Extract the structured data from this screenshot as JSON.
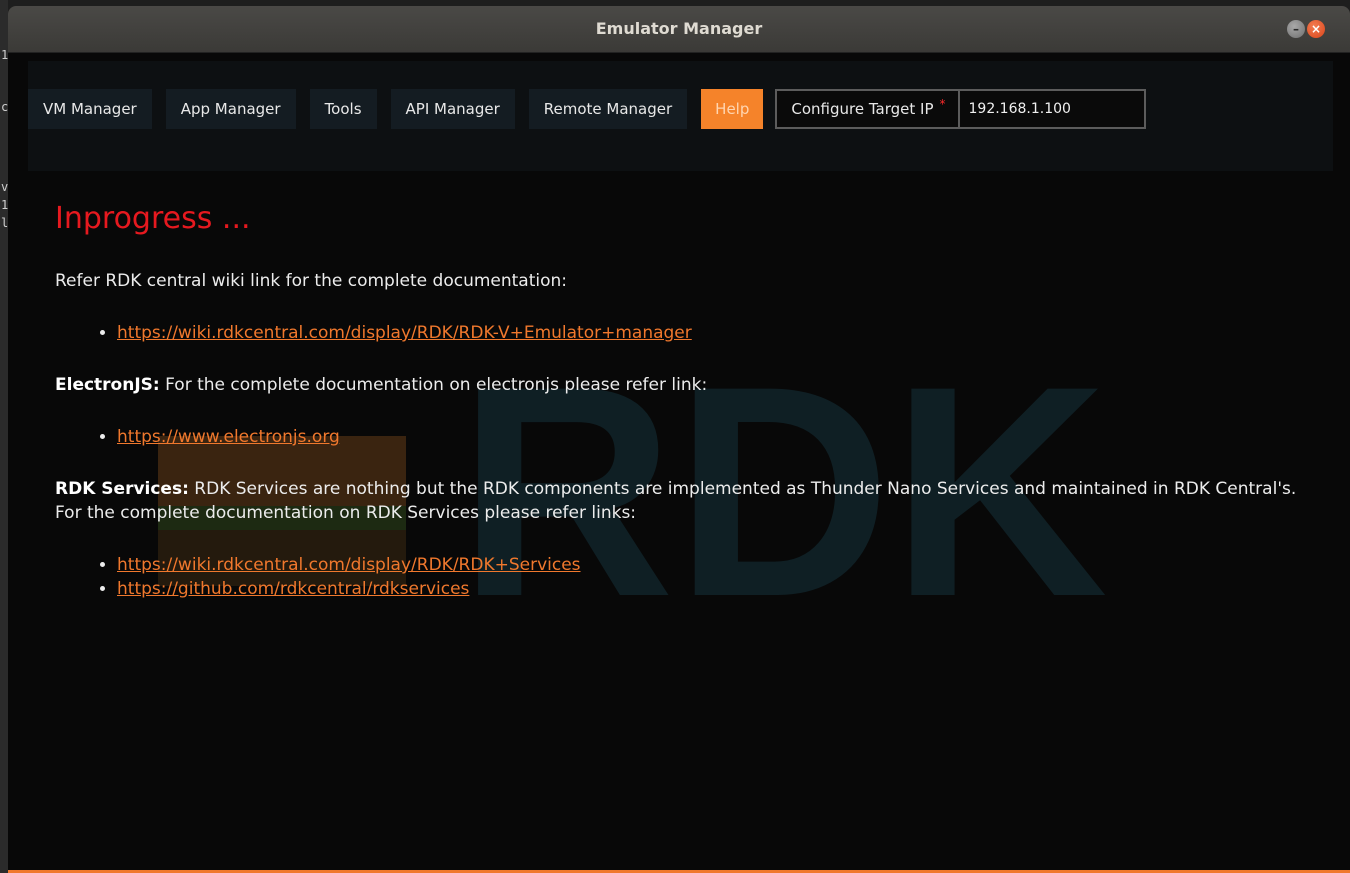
{
  "window": {
    "title": "Emulator Manager",
    "minimize_icon": "–",
    "close_icon": "×"
  },
  "nav": {
    "items": [
      {
        "label": "VM Manager"
      },
      {
        "label": "App Manager"
      },
      {
        "label": "Tools"
      },
      {
        "label": "API Manager"
      },
      {
        "label": "Remote Manager"
      },
      {
        "label": "Help",
        "active": true
      }
    ],
    "target": {
      "label": "Configure Target IP",
      "required_mark": "*",
      "value": "192.168.1.100"
    }
  },
  "content": {
    "heading": "Inprogress ...",
    "intro": "Refer RDK central wiki link for the complete documentation:",
    "wiki_link": "https://wiki.rdkcentral.com/display/RDK/RDK-V+Emulator+manager",
    "electron_label": "ElectronJS:",
    "electron_text": "For the complete documentation on electronjs please refer link:",
    "electron_link": "https://www.electronjs.org",
    "services_label": "RDK Services:",
    "services_text": "RDK Services are nothing but the RDK components are implemented as Thunder Nano Services and maintained in RDK Central's. For the complete documentation on RDK Services please refer links:",
    "services_links": [
      "https://wiki.rdkcentral.com/display/RDK/RDK+Services",
      "https://github.com/rdkcentral/rdkservices"
    ]
  },
  "watermark": {
    "text": "RDK",
    "colors": {
      "letters": "#0f1f24",
      "block_orange": "#3a2410",
      "block_green": "#1d2a12"
    }
  },
  "colors": {
    "accent": "#f5832a",
    "heading_red": "#e6191f",
    "link": "#f0782d"
  }
}
